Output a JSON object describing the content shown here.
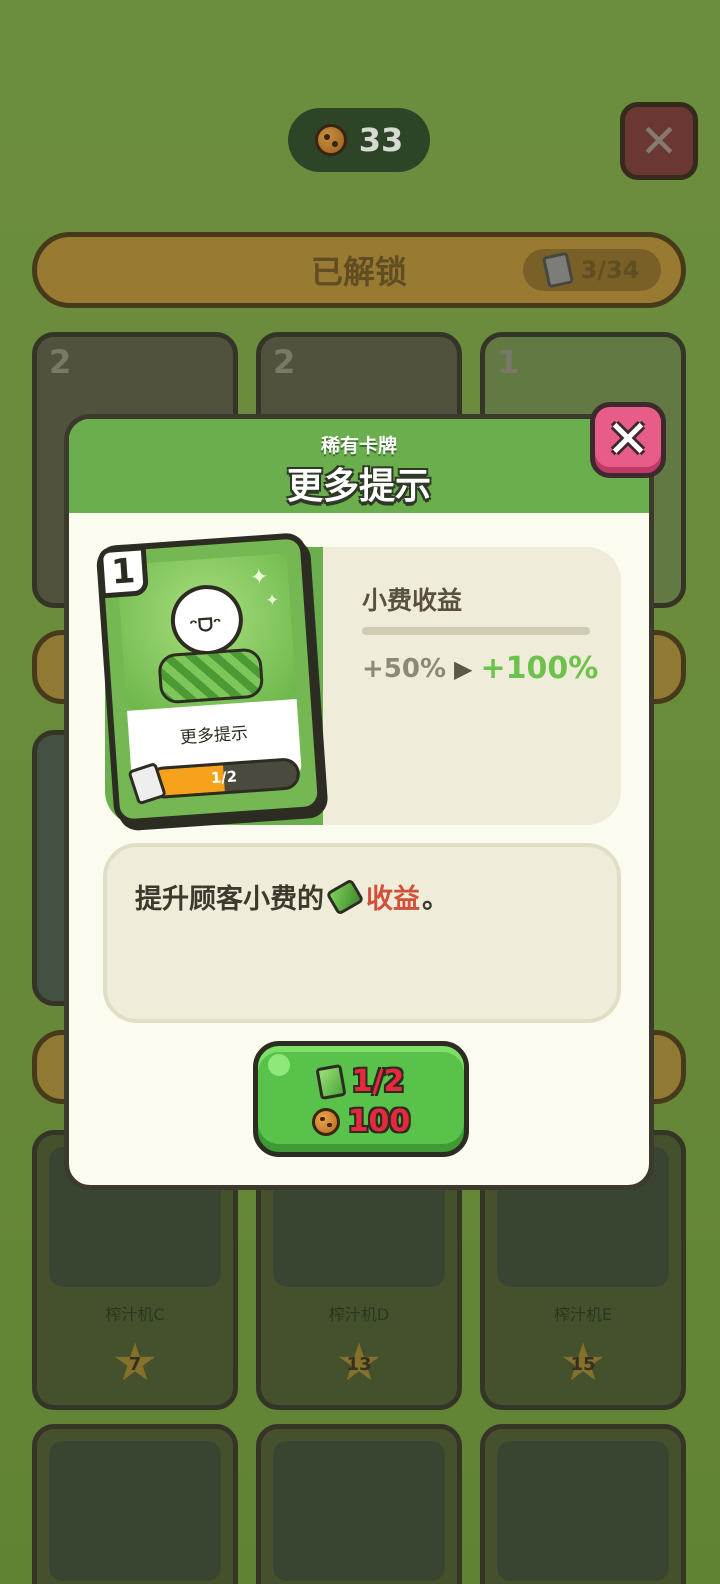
{
  "background": {
    "coin_count": "33",
    "unlocked_label": "已解锁",
    "unlocked_count": "3/34",
    "cards": [
      {
        "level": "2"
      },
      {
        "level": "2"
      },
      {
        "level": "1"
      }
    ],
    "slots": [
      {
        "label": "榨汁机C",
        "star": "7"
      },
      {
        "label": "榨汁机D",
        "star": "13"
      },
      {
        "label": "榨汁机E",
        "star": "15"
      }
    ]
  },
  "modal": {
    "rarity": "稀有卡牌",
    "title": "更多提示",
    "close_label": "✕",
    "card": {
      "level": "1",
      "name": "更多提示",
      "progress_text": "1/2",
      "progress_fraction": 0.5
    },
    "stat": {
      "label": "小费收益",
      "old_value": "+50%",
      "new_value": "+100%"
    },
    "description": {
      "prefix": "提升顾客小费的",
      "highlight": "收益",
      "suffix": "。"
    },
    "upgrade": {
      "cards_cost": "1/2",
      "coin_cost": "100"
    }
  },
  "colors": {
    "header_green": "#6aae4e",
    "button_green": "#59c24a",
    "close_pink": "#e85d88",
    "stat_new_green": "#6cc24a",
    "highlight_red": "#d0503a",
    "cost_red": "#e8283c"
  }
}
